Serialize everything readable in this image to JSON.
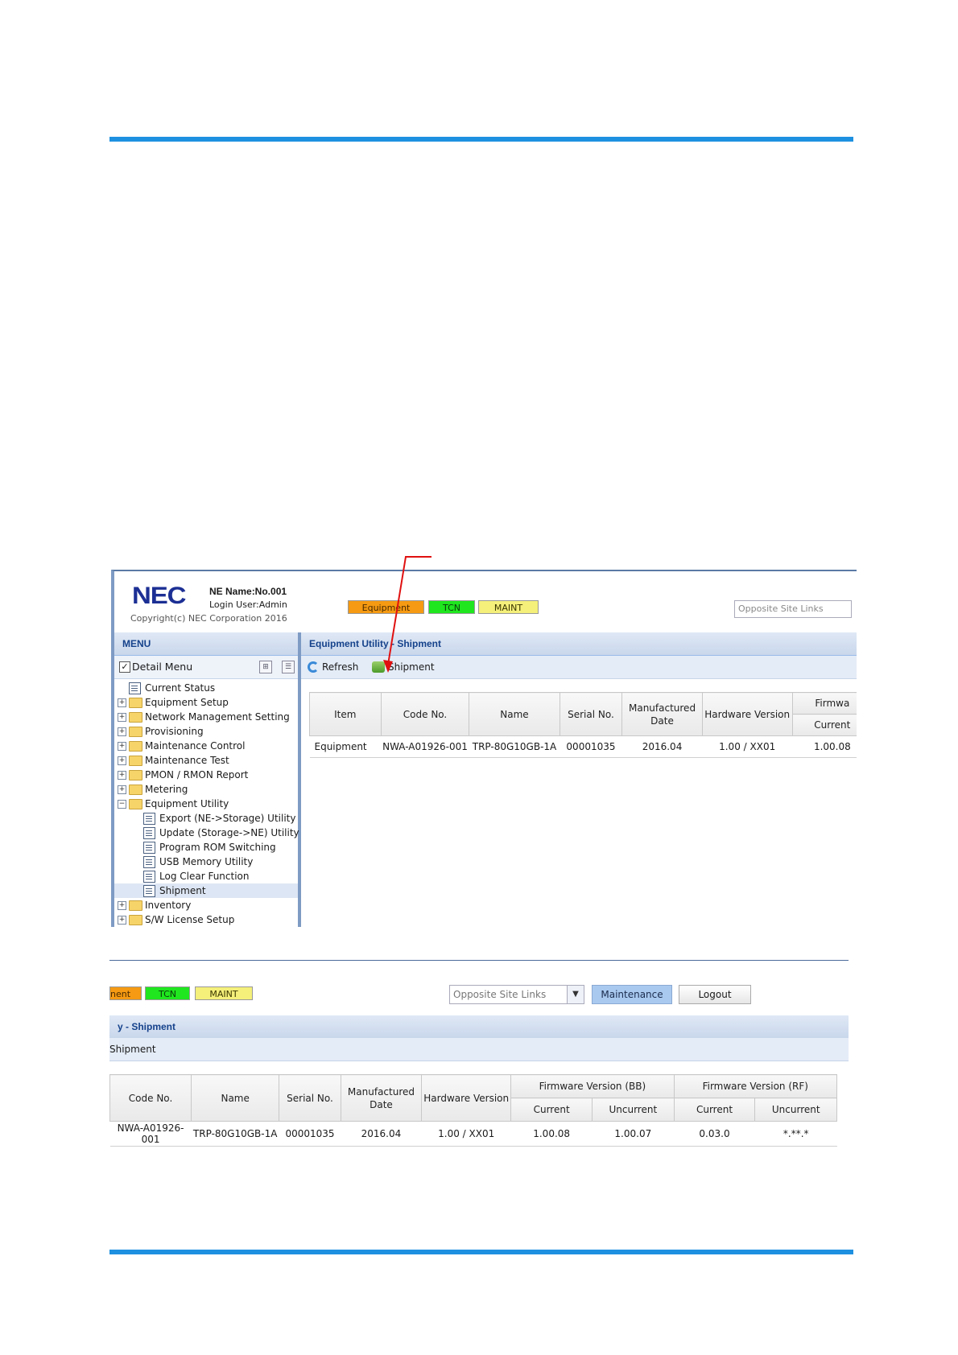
{
  "screenshot1": {
    "logo": "NEC",
    "ne_name": "NE Name:No.001",
    "login_user": "Login User:Admin",
    "copyright": "Copyright(c) NEC Corporation 2016",
    "badges": {
      "equipment": "Equipment",
      "tcn": "TCN",
      "maint": "MAINT"
    },
    "opposite_site_links": "Opposite Site Links",
    "menu": {
      "title": "MENU",
      "detail_menu": "Detail Menu",
      "items": [
        "Current Status",
        "Equipment Setup",
        "Network Management Setting",
        "Provisioning",
        "Maintenance Control",
        "Maintenance Test",
        "PMON / RMON Report",
        "Metering",
        "Equipment Utility",
        "Export (NE->Storage) Utility",
        "Update (Storage->NE) Utility",
        "Program ROM Switching",
        "USB Memory Utility",
        "Log Clear Function",
        "Shipment",
        "Inventory",
        "S/W License Setup"
      ]
    },
    "pane_title": "Equipment Utility - Shipment",
    "toolbar": {
      "refresh": "Refresh",
      "shipment": "Shipment"
    },
    "table": {
      "headers": [
        "Item",
        "Code No.",
        "Name",
        "Serial No.",
        "Manufactured Date",
        "Hardware Version",
        "Firmwa",
        "Current"
      ],
      "row": [
        "Equipment",
        "NWA-A01926-001",
        "TRP-80G10GB-1A",
        "00001035",
        "2016.04",
        "1.00 / XX01",
        "1.00.08"
      ]
    }
  },
  "screenshot2": {
    "badges": {
      "equipment": "nent",
      "tcn": "TCN",
      "maint": "MAINT"
    },
    "opposite_site_links": "Opposite Site Links",
    "maintenance": "Maintenance",
    "logout": "Logout",
    "pane_title": "y - Shipment",
    "toolbar_shipment": "Shipment",
    "table": {
      "headers": [
        "Code No.",
        "Name",
        "Serial No.",
        "Manufactured Date",
        "Hardware Version",
        "Firmware Version (BB)",
        "Firmware Version (RF)",
        "Current",
        "Uncurrent",
        "Current",
        "Uncurrent"
      ],
      "row": [
        "NWA-A01926-001",
        "TRP-80G10GB-1A",
        "00001035",
        "2016.04",
        "1.00 / XX01",
        "1.00.08",
        "1.00.07",
        "0.03.0",
        "*.**.*"
      ]
    }
  },
  "colors": {
    "rule": "#1e90e0",
    "arrow": "#e01010",
    "equipment": "#f59a12",
    "tcn": "#1fe61f",
    "maint": "#f4f07a"
  }
}
